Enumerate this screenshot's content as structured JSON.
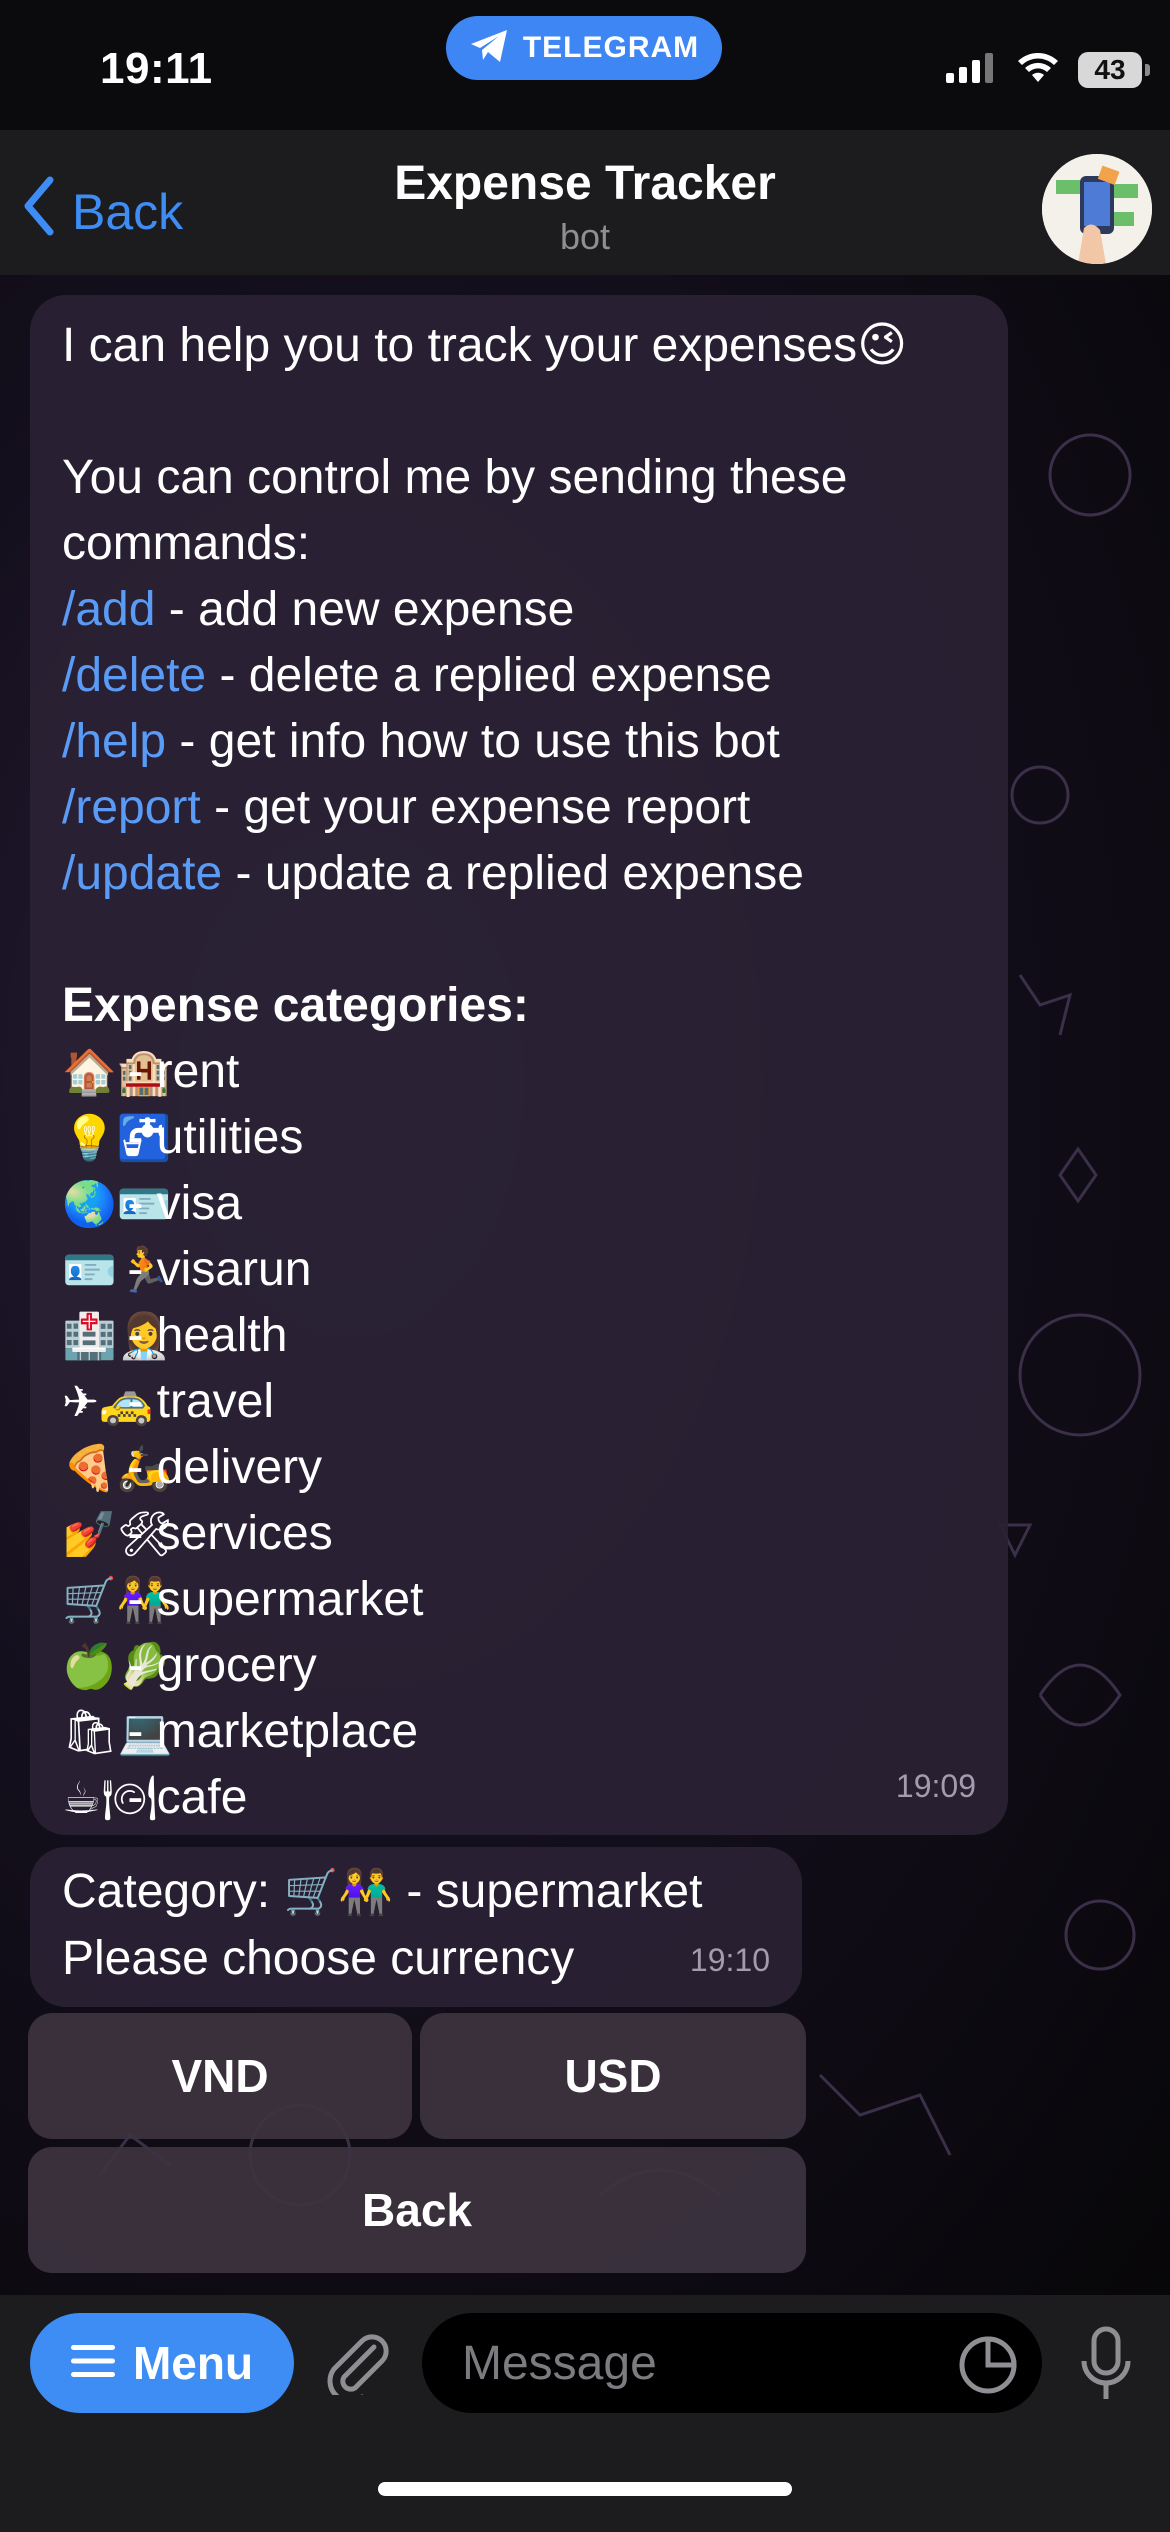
{
  "status_bar": {
    "time": "19:11",
    "telegram_label": "TELEGRAM",
    "battery": "43"
  },
  "header": {
    "back_label": "Back",
    "title": "Expense Tracker",
    "subtitle": "bot"
  },
  "messages": {
    "intro": {
      "line1": "I can help you to track your expenses",
      "line1_emoji": "😉",
      "line2": "You can control me by sending these",
      "line3": "commands:",
      "commands": [
        {
          "cmd": "/add",
          "desc": " - add new expense"
        },
        {
          "cmd": "/delete",
          "desc": " - delete a replied expense"
        },
        {
          "cmd": "/help",
          "desc": " - get info how to use this bot"
        },
        {
          "cmd": "/report",
          "desc": " - get your expense report"
        },
        {
          "cmd": "/update",
          "desc": " - update a replied expense"
        }
      ],
      "categories_title": "Expense categories:",
      "categories": [
        {
          "emoji": "🏠🏨",
          "label": " - rent"
        },
        {
          "emoji": "💡🚰",
          "label": " - utilities"
        },
        {
          "emoji": "🌏🪪",
          "label": " - visa"
        },
        {
          "emoji": "🪪🏃",
          "label": " - visarun"
        },
        {
          "emoji": "🏥👩‍⚕️",
          "label": " - health"
        },
        {
          "emoji": "✈🚕",
          "label": " - travel"
        },
        {
          "emoji": "🍕🛵",
          "label": " - delivery"
        },
        {
          "emoji": "💅🛠",
          "label": " - services"
        },
        {
          "emoji": "🛒👫",
          "label": " - supermarket"
        },
        {
          "emoji": "🍏🥬",
          "label": " - grocery"
        },
        {
          "emoji": "🛍💻",
          "label": " - marketplace"
        },
        {
          "emoji": "☕🍽",
          "label": " - cafe"
        }
      ],
      "time": "19:09"
    },
    "category_msg": {
      "prefix": "Category: ",
      "emoji": "🛒👫",
      "suffix": " - supermarket",
      "line2": "Please choose currency",
      "time": "19:10"
    }
  },
  "keyboard": {
    "vnd": "VND",
    "usd": "USD",
    "back": "Back"
  },
  "input_bar": {
    "menu_label": "Menu",
    "placeholder": "Message"
  },
  "colors": {
    "accent": "#3e8df4",
    "command_link": "#5a9bf6",
    "bubble": "#2a2234"
  }
}
